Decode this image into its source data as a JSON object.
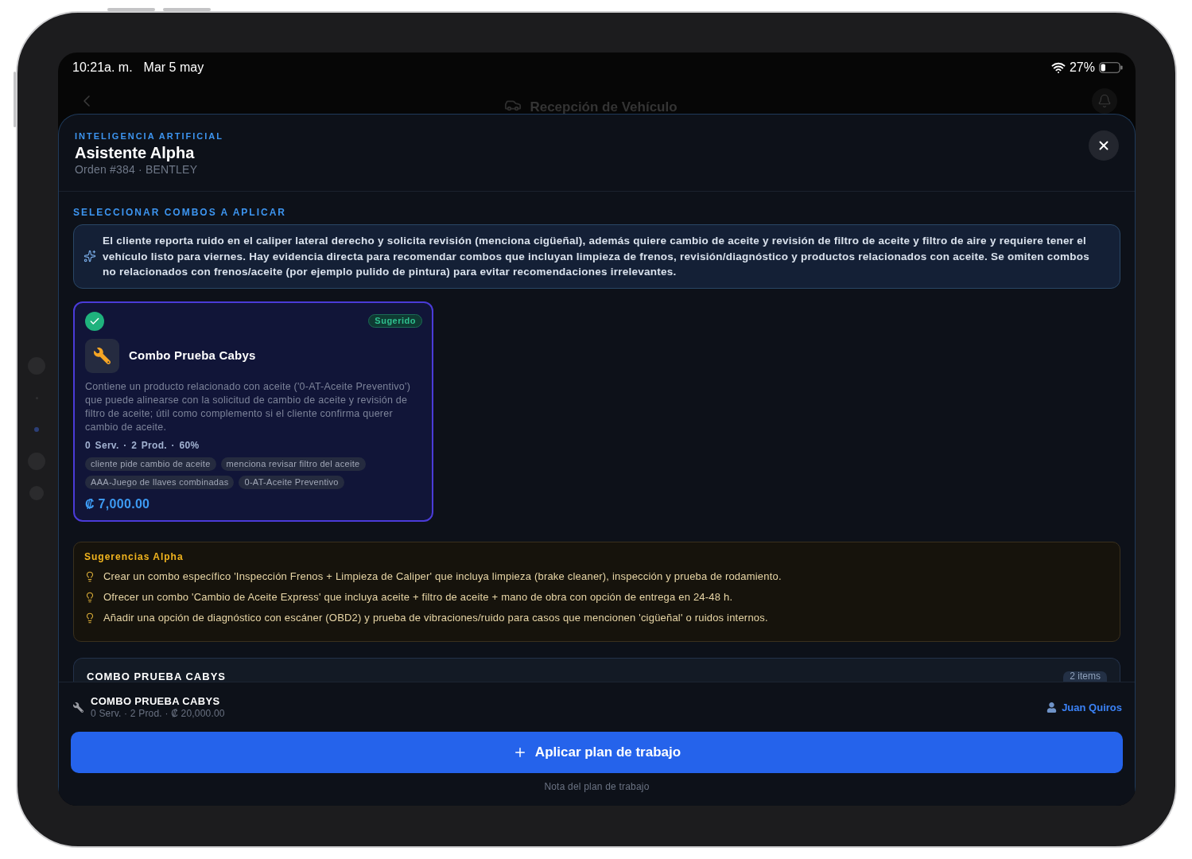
{
  "status_bar": {
    "time": "10:21a. m.",
    "date": "Mar 5 may",
    "battery": "27%"
  },
  "background_nav": {
    "title": "Recepción de Vehículo"
  },
  "sheet": {
    "eyebrow": "INTELIGENCIA ARTIFICIAL",
    "title": "Asistente Alpha",
    "subtitle": "Orden #384 · BENTLEY"
  },
  "section_label": "SELECCIONAR COMBOS A APLICAR",
  "summary": "El cliente reporta ruido en el caliper lateral derecho y solicita revisión (menciona cigüeñal), además quiere cambio de aceite y revisión de filtro de aceite y filtro de aire y requiere tener el vehículo listo para viernes. Hay evidencia directa para recomendar combos que incluyan limpieza de frenos, revisión/diagnóstico y productos relacionados con aceite. Se omiten combos no relacionados con frenos/aceite (por ejemplo pulido de pintura) para evitar recomendaciones irrelevantes.",
  "combos": [
    {
      "selected": true,
      "badge": "Sugerido",
      "name": "Combo Prueba Cabys",
      "description": "Contiene un producto relacionado con aceite ('0-AT-Aceite Preventivo') que puede alinearse con la solicitud de cambio de aceite y revisión de filtro de aceite; útil como complemento si el cliente confirma querer cambio de aceite.",
      "stats": "0 Serv. · 2 Prod. · 60%",
      "tags": [
        "cliente pide cambio de aceite",
        "menciona revisar filtro del aceite",
        "AAA-Juego de llaves combinadas",
        "0-AT-Aceite Preventivo"
      ],
      "price": "₡ 7,000.00"
    }
  ],
  "suggestions": {
    "title": "Sugerencias Alpha",
    "items": [
      "Crear un combo específico 'Inspección Frenos + Limpieza de Caliper' que incluya limpieza (brake cleaner), inspección y prueba de rodamiento.",
      "Ofrecer un combo 'Cambio de Aceite Express' que incluya aceite + filtro de aceite + mano de obra con opción de entrega en 24-48 h.",
      "Añadir una opción de diagnóstico con escáner (OBD2) y prueba de vibraciones/ruido para casos que mencionen 'cigüeñal' o ruidos internos."
    ]
  },
  "combo_section": {
    "title": "COMBO PRUEBA CABYS",
    "count": "2 items"
  },
  "footer": {
    "plan_title": "COMBO PRUEBA CABYS",
    "plan_details": "0 Serv. · 2 Prod. · ₡ 20,000.00",
    "assignee": "Juan Quiros",
    "apply_button": "Aplicar plan de trabajo",
    "note": "Nota del plan de trabajo"
  }
}
